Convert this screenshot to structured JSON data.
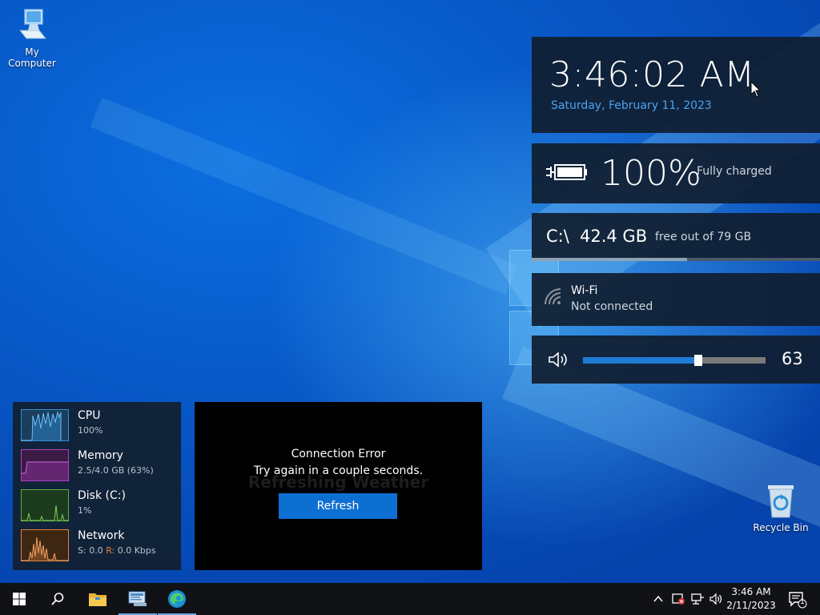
{
  "desktop": {
    "icons": [
      {
        "label": "My Computer",
        "icon": "computer-icon"
      },
      {
        "label": "Recycle Bin",
        "icon": "recycle-bin-icon"
      }
    ]
  },
  "clock_widget": {
    "time": "3:46:02 AM",
    "date": "Saturday, February 11, 2023",
    "date_color": "#4aa3f0"
  },
  "battery_widget": {
    "percent": "100%",
    "status": "Fully charged",
    "icon": "battery-icon"
  },
  "disk_widget": {
    "drive": "C:\\",
    "free": "42.4 GB",
    "note": "free out of 79 GB",
    "free_fraction": 0.54
  },
  "wifi_widget": {
    "title": "Wi-Fi",
    "status": "Not connected",
    "icon": "wifi-icon"
  },
  "volume_widget": {
    "level": 63,
    "level_label": "63",
    "icon": "speaker-icon"
  },
  "system_monitor": {
    "items": [
      {
        "name": "CPU",
        "value": "100%",
        "color": "#2f8fd8"
      },
      {
        "name": "Memory",
        "value": "2.5/4.0 GB (63%)",
        "color": "#b13ec2"
      },
      {
        "name": "Disk (C:)",
        "value": "1%",
        "color": "#5fae3b"
      },
      {
        "name": "Network",
        "s_label": "S:",
        "s_value": " 0.0 ",
        "r_label": "R:",
        "r_value": " 0.0 Kbps",
        "color": "#e0833c"
      }
    ]
  },
  "news_panel": {
    "ghost_text": "Refreshing Weather",
    "error_title": "Connection Error",
    "error_message": "Try again in a couple seconds.",
    "refresh_label": "Refresh",
    "accent": "#0e6fd3"
  },
  "taskbar": {
    "buttons": [
      "start-icon",
      "search-icon",
      "file-explorer-icon",
      "server-manager-icon",
      "edge-icon"
    ],
    "tray_time": "3:46 AM",
    "tray_date": "2/11/2023",
    "notification_count": "1"
  }
}
